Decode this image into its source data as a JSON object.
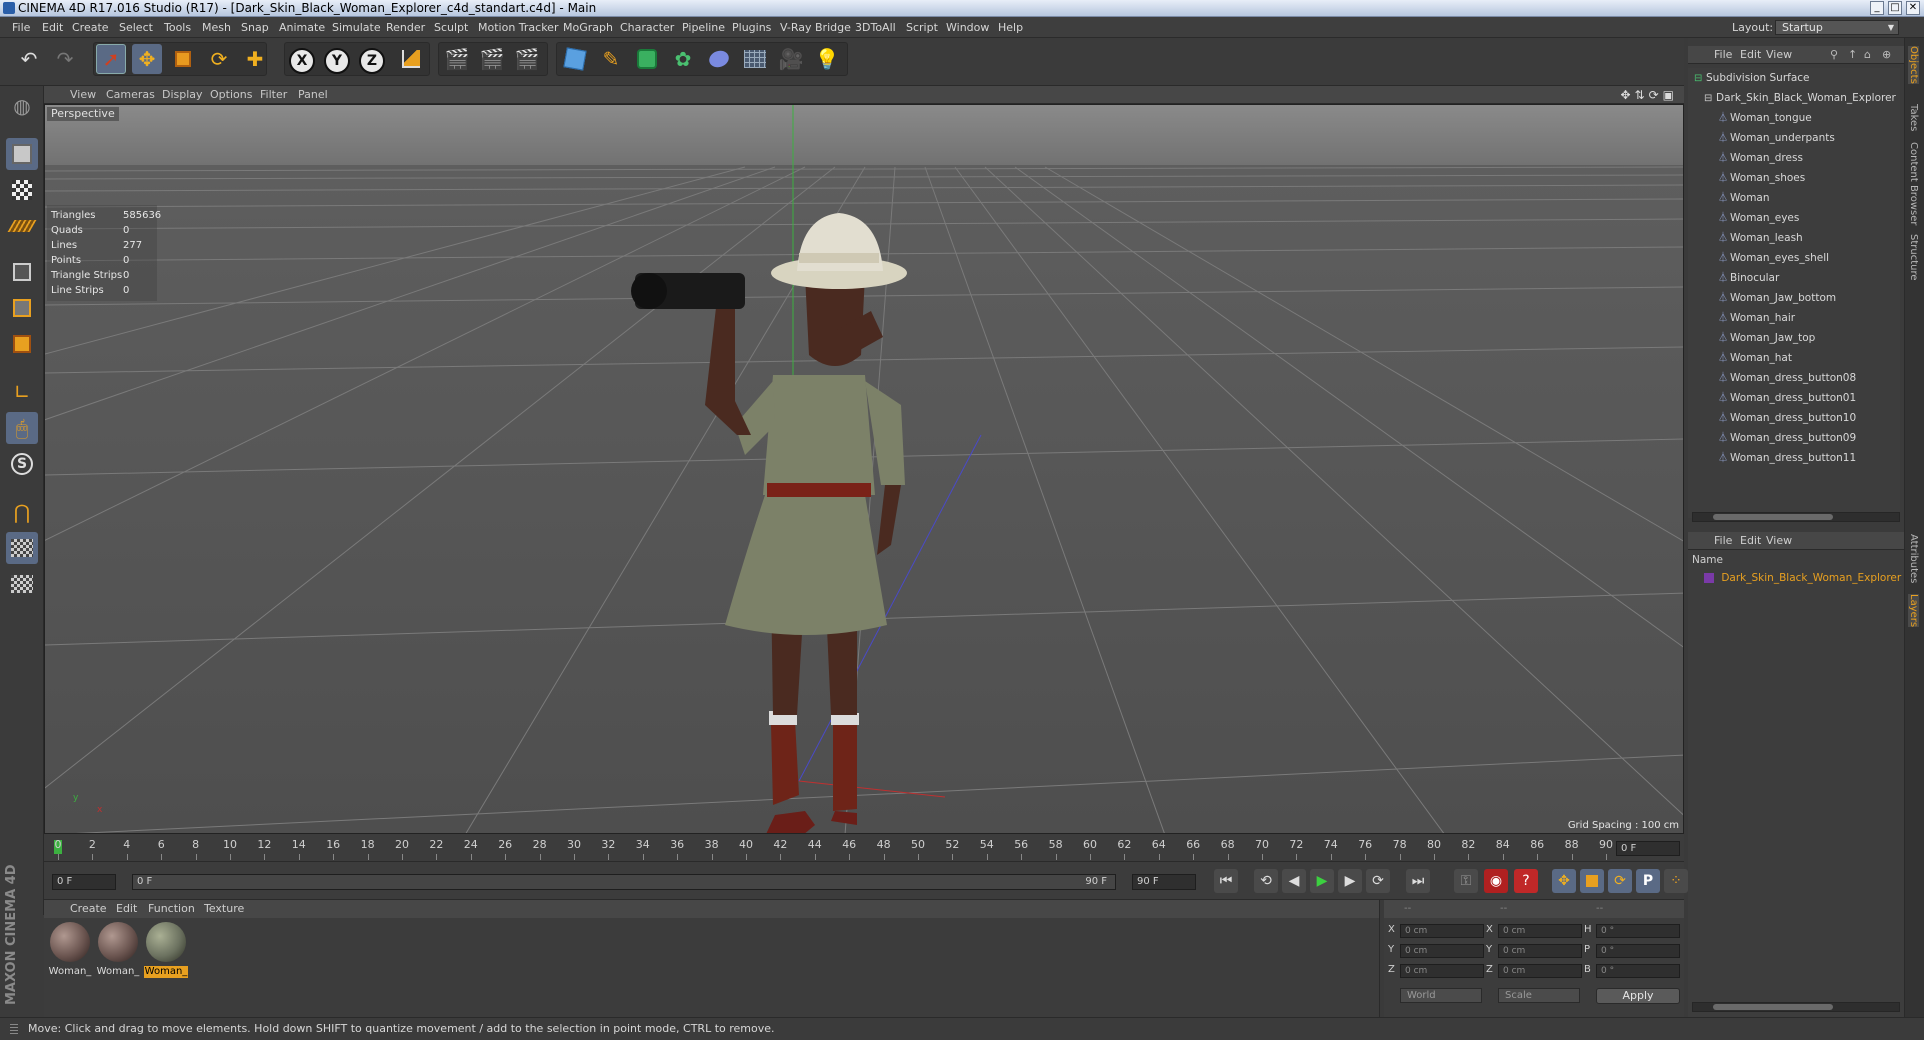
{
  "window": {
    "title": "CINEMA 4D R17.016 Studio (R17) - [Dark_Skin_Black_Woman_Explorer_c4d_standart.c4d] - Main",
    "controls": [
      "_",
      "□",
      "✕"
    ]
  },
  "menubar": {
    "items": [
      "File",
      "Edit",
      "Create",
      "Select",
      "Tools",
      "Mesh",
      "Snap",
      "Animate",
      "Simulate",
      "Render",
      "Sculpt",
      "Motion Tracker",
      "MoGraph",
      "Character",
      "Pipeline",
      "Plugins",
      "V-Ray Bridge",
      "3DToAll",
      "Script",
      "Window",
      "Help"
    ],
    "layout_label": "Layout:",
    "layout_value": "Startup"
  },
  "toolbar": {
    "undo_icon": "↶",
    "redo_icon": "↷",
    "axis_x": "X",
    "axis_y": "Y",
    "axis_z": "Z"
  },
  "viewport": {
    "menu": [
      "View",
      "Cameras",
      "Display",
      "Options",
      "Filter",
      "Panel"
    ],
    "camera_label": "Perspective",
    "nav_icons": "✥⇅⟳▣",
    "stats": [
      {
        "label": "Triangles",
        "value": "585636"
      },
      {
        "label": "Quads",
        "value": "0"
      },
      {
        "label": "Lines",
        "value": "277"
      },
      {
        "label": "Points",
        "value": "0"
      },
      {
        "label": "Triangle Strips",
        "value": "0"
      },
      {
        "label": "Line Strips",
        "value": "0"
      }
    ],
    "grid_spacing": "Grid Spacing : 100 cm",
    "axis_y_label": "y",
    "axis_x_label": "x"
  },
  "timeline": {
    "ticks": [
      "0",
      "2",
      "4",
      "6",
      "8",
      "10",
      "12",
      "14",
      "16",
      "18",
      "20",
      "22",
      "24",
      "26",
      "28",
      "30",
      "32",
      "34",
      "36",
      "38",
      "40",
      "42",
      "44",
      "46",
      "48",
      "50",
      "52",
      "54",
      "56",
      "58",
      "60",
      "62",
      "64",
      "66",
      "68",
      "70",
      "72",
      "74",
      "76",
      "78",
      "80",
      "82",
      "84",
      "86",
      "88",
      "90"
    ],
    "current_frame": "0 F",
    "start_field": "0 F",
    "range_start": "0 F",
    "range_end": "90 F",
    "end_field": "90 F"
  },
  "playback": {
    "first": "⏮",
    "prev_key": "⟲",
    "prev": "◀",
    "play": "▶",
    "next": "▶",
    "next_key": "⟳",
    "last": "⏭"
  },
  "material_manager": {
    "menu": [
      "Create",
      "Edit",
      "Function",
      "Texture"
    ],
    "materials": [
      {
        "label": "Woman_",
        "color": "#6b5550",
        "selected": false
      },
      {
        "label": "Woman_",
        "color": "#6b5550",
        "selected": false
      },
      {
        "label": "Woman_",
        "color": "#6c7260",
        "selected": true
      }
    ]
  },
  "coordinates": {
    "header": [
      "--",
      "--",
      "--"
    ],
    "rows": [
      {
        "l1": "X",
        "v1": "0 cm",
        "l2": "X",
        "v2": "0 cm",
        "l3": "H",
        "v3": "0 °"
      },
      {
        "l1": "Y",
        "v1": "0 cm",
        "l2": "Y",
        "v2": "0 cm",
        "l3": "P",
        "v3": "0 °"
      },
      {
        "l1": "Z",
        "v1": "0 cm",
        "l2": "Z",
        "v2": "0 cm",
        "l3": "B",
        "v3": "0 °"
      }
    ],
    "mode": "World",
    "transform": "Scale",
    "apply": "Apply"
  },
  "branding": "MAXON CINEMA 4D",
  "status": "Move: Click and drag to move elements. Hold down SHIFT to quantize movement / add to the selection in point mode, CTRL to remove.",
  "object_manager": {
    "menu": [
      "File",
      "Edit",
      "View"
    ],
    "root": "Subdivision Surface",
    "group": "Dark_Skin_Black_Woman_Explorer",
    "objects": [
      "Woman_tongue",
      "Woman_underpants",
      "Woman_dress",
      "Woman_shoes",
      "Woman",
      "Woman_eyes",
      "Woman_leash",
      "Woman_eyes_shell",
      "Binocular",
      "Woman_Jaw_bottom",
      "Woman_hair",
      "Woman_Jaw_top",
      "Woman_hat",
      "Woman_dress_button08",
      "Woman_dress_button01",
      "Woman_dress_button10",
      "Woman_dress_button09",
      "Woman_dress_button11"
    ]
  },
  "layer_manager": {
    "menu": [
      "File",
      "Edit",
      "View"
    ],
    "column": "Name",
    "layer": "Dark_Skin_Black_Woman_Explorer",
    "layer_color": "#7a3aa8"
  },
  "side_tabs": [
    "Objects",
    "Takes",
    "Content Browser",
    "Structure",
    "Attributes",
    "Layers"
  ]
}
